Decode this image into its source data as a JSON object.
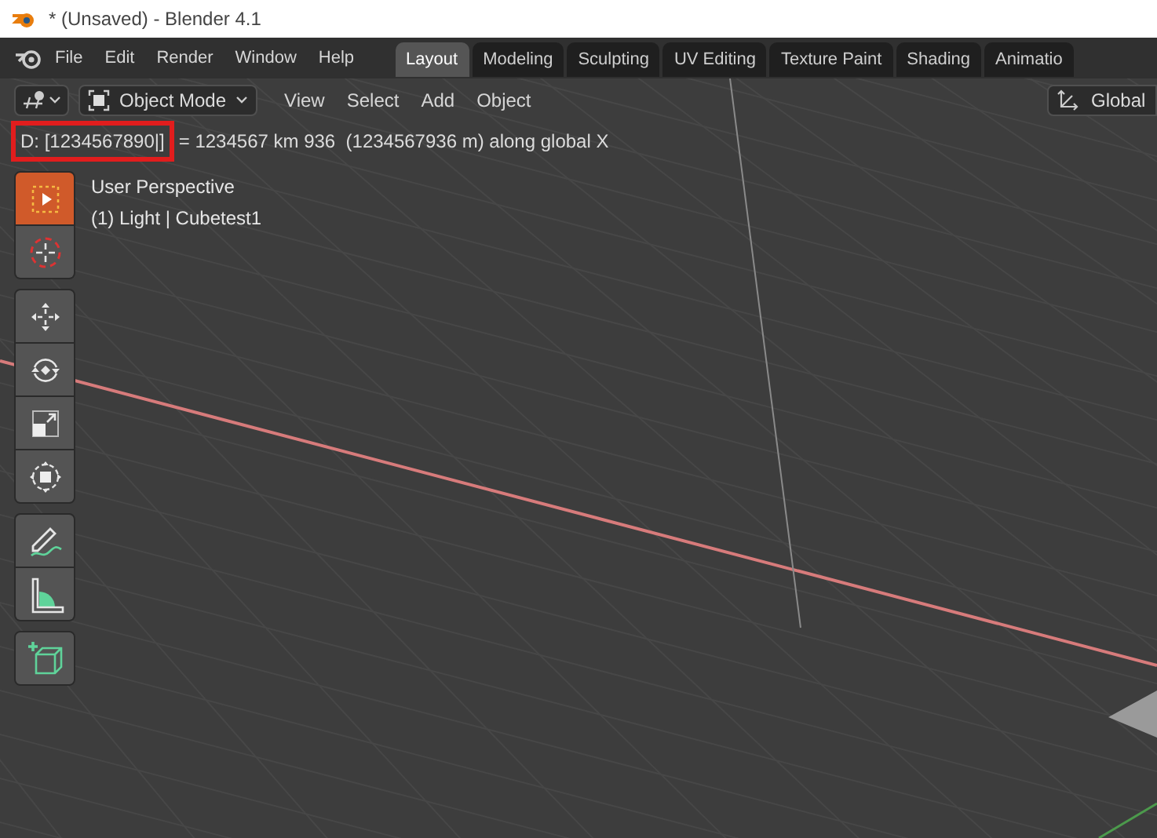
{
  "window": {
    "title": "* (Unsaved) - Blender 4.1"
  },
  "menu": [
    "File",
    "Edit",
    "Render",
    "Window",
    "Help"
  ],
  "workspace_tabs": [
    {
      "label": "Layout",
      "selected": true
    },
    {
      "label": "Modeling",
      "selected": false
    },
    {
      "label": "Sculpting",
      "selected": false
    },
    {
      "label": "UV Editing",
      "selected": false
    },
    {
      "label": "Texture Paint",
      "selected": false
    },
    {
      "label": "Shading",
      "selected": false
    },
    {
      "label": "Animatio",
      "selected": false
    }
  ],
  "header": {
    "mode": "Object Mode",
    "menus": [
      "View",
      "Select",
      "Add",
      "Object"
    ],
    "orientation": "Global"
  },
  "operator_status": {
    "input": "D: [1234567890|]",
    "result": "= 1234567 km 936  (1234567936 m) along global X"
  },
  "viewport": {
    "view_name": "User Perspective",
    "object_info": "(1) Light | Cubetest1"
  },
  "toolbar": [
    [
      {
        "kind": "select",
        "selected": true
      },
      {
        "kind": "cursor",
        "selected": false
      }
    ],
    [
      {
        "kind": "move",
        "selected": false
      },
      {
        "kind": "rotate",
        "selected": false
      },
      {
        "kind": "scale",
        "selected": false
      },
      {
        "kind": "transform",
        "selected": false
      }
    ],
    [
      {
        "kind": "annotate",
        "selected": false
      },
      {
        "kind": "measure",
        "selected": false
      }
    ],
    [
      {
        "kind": "add-cube",
        "selected": false
      }
    ]
  ]
}
